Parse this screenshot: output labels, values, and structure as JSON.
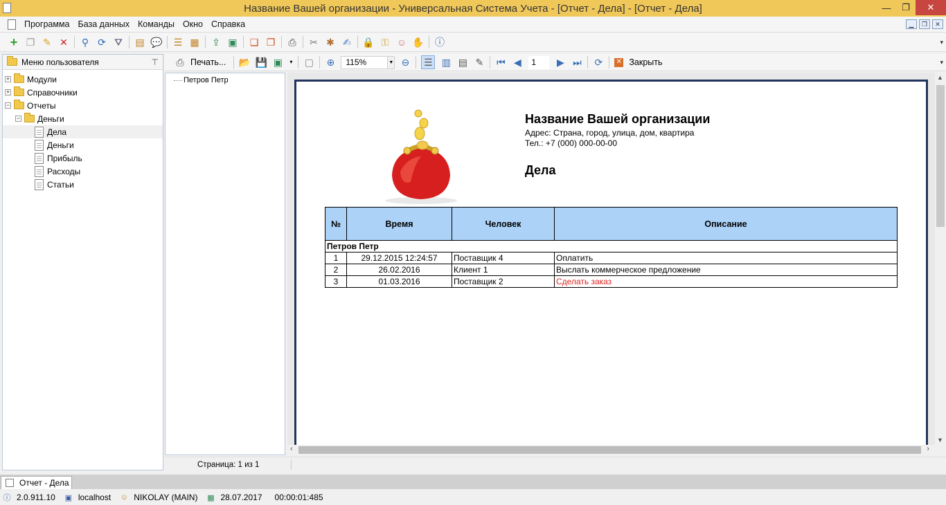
{
  "window": {
    "title": "Название Вашей организации - Универсальная Система Учета - [Отчет - Дела] - [Отчет - Дела]",
    "minimize": "—",
    "restore": "❐",
    "close": "✕"
  },
  "menu": [
    "Программа",
    "База данных",
    "Команды",
    "Окно",
    "Справка"
  ],
  "toolbar_icons": [
    "add-icon",
    "copy-icon",
    "edit-icon",
    "delete-icon",
    "search-icon",
    "refresh-icon",
    "filter-icon",
    "import-icon",
    "comment-icon",
    "tree-icon",
    "group-icon",
    "export-icon",
    "export-excel-icon",
    "new-window-icon",
    "close-window-icon",
    "print-menu-icon",
    "tools-icon",
    "settings-icon",
    "note-icon",
    "lock-icon",
    "key-icon",
    "users-icon",
    "permissions-icon",
    "info-icon"
  ],
  "left_panel": {
    "title": "Меню пользователя",
    "tree": [
      {
        "label": "Модули",
        "type": "folder",
        "expander": "+",
        "level": 0
      },
      {
        "label": "Справочники",
        "type": "folder",
        "expander": "+",
        "level": 0
      },
      {
        "label": "Отчеты",
        "type": "folder",
        "expander": "−",
        "level": 0
      },
      {
        "label": "Деньги",
        "type": "folder",
        "expander": "−",
        "level": 1
      },
      {
        "label": "Дела",
        "type": "report",
        "level": 2,
        "selected": true
      },
      {
        "label": "Деньги",
        "type": "report",
        "level": 2
      },
      {
        "label": "Прибыль",
        "type": "report",
        "level": 2
      },
      {
        "label": "Расходы",
        "type": "report",
        "level": 2
      },
      {
        "label": "Статьи",
        "type": "report",
        "level": 2
      }
    ]
  },
  "preview_toolbar": {
    "print_label": "Печать...",
    "zoom": "115%",
    "page_number": "1",
    "close_label": "Закрыть"
  },
  "outline": {
    "node": "Петров Петр"
  },
  "report": {
    "org_name": "Название Вашей организации",
    "address": "Адрес: Страна, город, улица, дом, квартира",
    "phone": "Тел.: +7 (000) 000-00-00",
    "title": "Дела",
    "columns": [
      "№",
      "Время",
      "Человек",
      "Описание"
    ],
    "group": "Петров Петр",
    "rows": [
      {
        "n": "1",
        "time": "29.12.2015 12:24:57",
        "person": "Поставщик 4",
        "desc": "Оплатить",
        "highlight": false
      },
      {
        "n": "2",
        "time": "26.02.2016",
        "person": "Клиент 1",
        "desc": "Выслать коммерческое предложение",
        "highlight": false
      },
      {
        "n": "3",
        "time": "01.03.2016",
        "person": "Поставщик 2",
        "desc": "Сделать заказ",
        "highlight": true
      }
    ],
    "highlight_color": "#e02020",
    "header_color": "#acd2f7"
  },
  "preview_status": {
    "page_info": "Страница: 1 из 1"
  },
  "tabs": [
    {
      "label": "Отчет - Дела"
    }
  ],
  "statusbar": {
    "version": "2.0.911.10",
    "server": "localhost",
    "user": "NIKOLAY (MAIN)",
    "date": "28.07.2017",
    "elapsed": "00:00:01:485"
  }
}
